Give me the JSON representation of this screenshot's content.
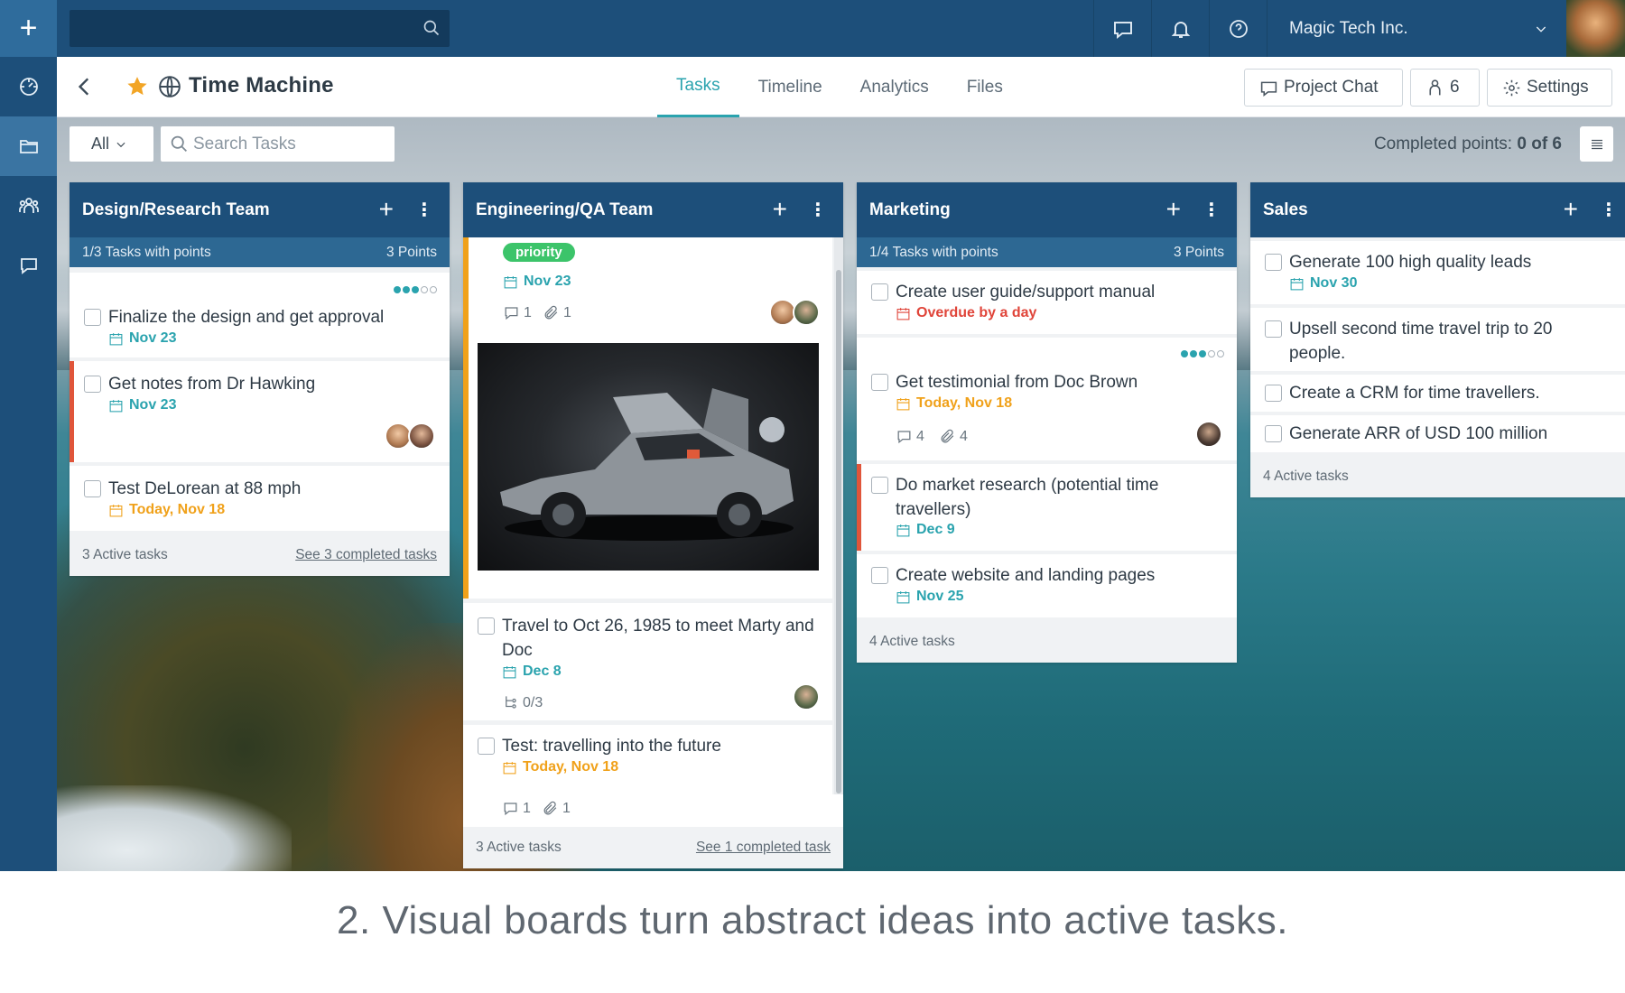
{
  "topbar": {
    "company": "Magic Tech Inc."
  },
  "project": {
    "title": "Time Machine",
    "tabs": [
      {
        "label": "Tasks",
        "active": true
      },
      {
        "label": "Timeline",
        "active": false
      },
      {
        "label": "Analytics",
        "active": false
      },
      {
        "label": "Files",
        "active": false
      }
    ],
    "chat_label": "Project Chat",
    "members_count": "6",
    "settings_label": "Settings"
  },
  "filter": {
    "scope": "All",
    "search_placeholder": "Search Tasks",
    "completed_label": "Completed points:",
    "completed_value": "0 of 6"
  },
  "columns": {
    "design": {
      "title": "Design/Research Team",
      "sub_left": "1/3 Tasks with points",
      "sub_right": "3 Points",
      "cards": [
        {
          "title": "Finalize the design and get approval",
          "due": "Nov 23",
          "points_dots": [
            1,
            1,
            1,
            0,
            0
          ]
        },
        {
          "title": "Get notes from Dr Hawking",
          "due": "Nov 23"
        },
        {
          "title": "Test DeLorean at 88 mph",
          "due": "Today, Nov 18"
        }
      ],
      "footer_left": "3 Active tasks",
      "footer_right": "See 3 completed tasks"
    },
    "engineering": {
      "title": "Engineering/QA Team",
      "cards": [
        {
          "tag": "priority",
          "due": "Nov 23",
          "comments": "1",
          "attachments": "1"
        },
        {
          "title": "Travel to Oct 26, 1985 to meet Marty and Doc",
          "due": "Dec 8",
          "subtasks": "0/3"
        },
        {
          "title": "Test: travelling into the future",
          "due": "Today, Nov 18",
          "comments": "1",
          "attachments": "1"
        }
      ],
      "footer_left": "3 Active tasks",
      "footer_right": "See 1 completed task"
    },
    "marketing": {
      "title": "Marketing",
      "sub_left": "1/4 Tasks with points",
      "sub_right": "3 Points",
      "cards": [
        {
          "title": "Create user guide/support manual",
          "due": "Overdue by a day"
        },
        {
          "title": "Get testimonial from Doc Brown",
          "due": "Today, Nov 18",
          "comments": "4",
          "attachments": "4"
        },
        {
          "title": "Do market research (potential time travellers)",
          "due": "Dec 9"
        },
        {
          "title": "Create website and landing pages",
          "due": "Nov 25"
        }
      ],
      "footer_left": "4 Active tasks"
    },
    "sales": {
      "title": "Sales",
      "cards": [
        {
          "title": "Generate 100 high quality leads",
          "due": "Nov 30"
        },
        {
          "title": "Upsell second time travel trip to 20 people."
        },
        {
          "title": "Create a CRM for time travellers."
        },
        {
          "title": "Generate ARR of USD 100 million"
        }
      ],
      "footer_left": "4 Active tasks"
    }
  },
  "caption": "2. Visual boards turn abstract ideas into active tasks.",
  "colors": {
    "navy": "#1d4f7a",
    "teal": "#2aa3ae",
    "overdue": "#e0453a",
    "today": "#f0a11a",
    "priority": "#3cc46a"
  }
}
